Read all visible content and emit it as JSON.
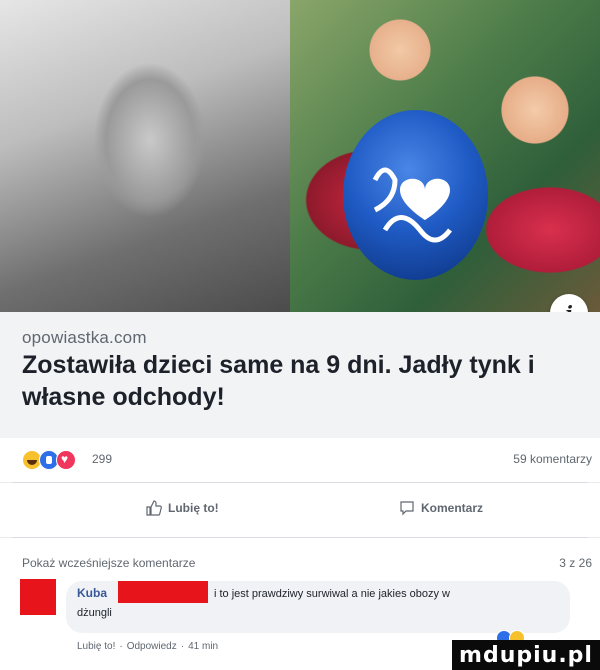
{
  "post": {
    "source_domain": "opowiastka.com",
    "headline": "Zostawiła dzieci same na 9 dni. Jadły tynk i własne odchody!",
    "info_badge": "i"
  },
  "reactions": {
    "count": "299",
    "comments_count": "59 komentarzy",
    "icons": [
      "haha-icon",
      "like-icon",
      "love-icon"
    ]
  },
  "actions": {
    "like_label": "Lubię to!",
    "comment_label": "Komentarz"
  },
  "comments_header": {
    "show_previous": "Pokaż wcześniejsze komentarze",
    "page_count": "3 z 26"
  },
  "comment": {
    "author": "Kuba",
    "text_line1": "i to jest prawdziwy surwiwal a nie jakies obozy w",
    "text_line2": "dżungli",
    "like_link": "Lubię to!",
    "reply_link": "Odpowiedz",
    "time": "41 min"
  },
  "watermark": "mdupiu.pl",
  "colors": {
    "accent": "#385898",
    "redaction": "#e8141b",
    "headline": "#1d2129",
    "meta": "#606770"
  }
}
